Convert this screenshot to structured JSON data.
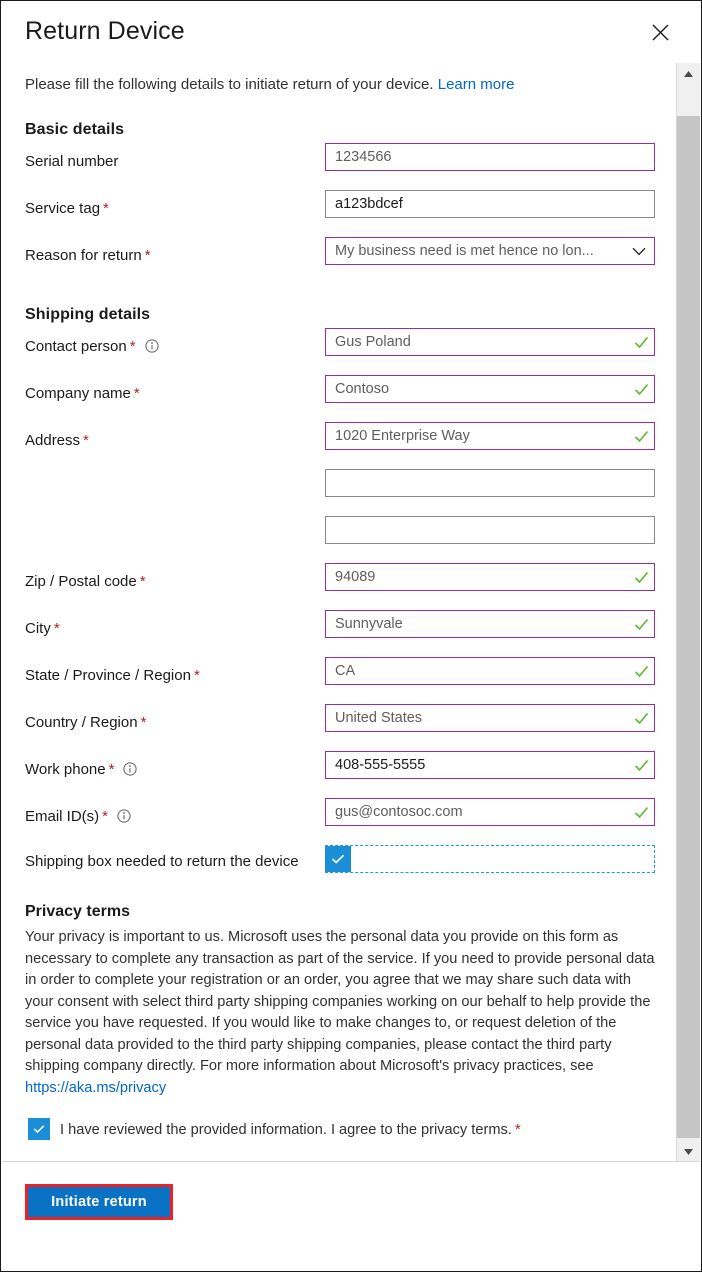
{
  "dialog": {
    "title": "Return Device",
    "close_icon": "close-icon",
    "intro_text": "Please fill the following details to initiate return of your device.",
    "intro_link": "Learn more"
  },
  "basic_details": {
    "heading": "Basic details",
    "fields": [
      {
        "label": "Serial number",
        "required": false,
        "info": false,
        "value": "1234566",
        "state": "valid",
        "muted": true,
        "checked": false,
        "dropdown": false
      },
      {
        "label": "Service tag",
        "required": true,
        "info": false,
        "value": "a123bdcef",
        "state": "normal",
        "muted": false,
        "checked": false,
        "dropdown": false
      },
      {
        "label": "Reason for return",
        "required": true,
        "info": false,
        "value": "My business need is met hence no lon...",
        "state": "valid",
        "muted": true,
        "checked": false,
        "dropdown": true
      }
    ]
  },
  "shipping_details": {
    "heading": "Shipping details",
    "fields": [
      {
        "label": "Contact person",
        "required": true,
        "info": true,
        "value": "Gus Poland",
        "state": "valid",
        "muted": true,
        "checked": true,
        "dropdown": false
      },
      {
        "label": "Company name",
        "required": true,
        "info": false,
        "value": "Contoso",
        "state": "valid",
        "muted": true,
        "checked": true,
        "dropdown": false
      },
      {
        "label": "Address",
        "required": true,
        "info": false,
        "value": "1020 Enterprise Way",
        "state": "valid",
        "muted": true,
        "checked": true,
        "dropdown": false
      },
      {
        "label": "",
        "required": false,
        "info": false,
        "value": "",
        "state": "normal",
        "muted": false,
        "checked": false,
        "dropdown": false
      },
      {
        "label": "",
        "required": false,
        "info": false,
        "value": "",
        "state": "normal",
        "muted": false,
        "checked": false,
        "dropdown": false
      },
      {
        "label": "Zip / Postal code",
        "required": true,
        "info": false,
        "value": "94089",
        "state": "valid",
        "muted": true,
        "checked": true,
        "dropdown": false
      },
      {
        "label": "City",
        "required": true,
        "info": false,
        "value": "Sunnyvale",
        "state": "valid",
        "muted": true,
        "checked": true,
        "dropdown": false
      },
      {
        "label": "State / Province / Region",
        "required": true,
        "info": false,
        "value": "CA",
        "state": "valid",
        "muted": true,
        "checked": true,
        "dropdown": false
      },
      {
        "label": "Country / Region",
        "required": true,
        "info": false,
        "value": "United States",
        "state": "valid",
        "muted": true,
        "checked": true,
        "dropdown": false
      },
      {
        "label": "Work phone",
        "required": true,
        "info": true,
        "value": "408-555-5555",
        "state": "valid",
        "muted": false,
        "checked": true,
        "dropdown": false
      },
      {
        "label": "Email ID(s)",
        "required": true,
        "info": true,
        "value": "gus@contosoc.com",
        "state": "valid",
        "muted": true,
        "checked": true,
        "dropdown": false
      }
    ],
    "shipping_box": {
      "label": "Shipping box needed to return the device",
      "checked": true
    }
  },
  "privacy": {
    "heading": "Privacy terms",
    "body": "Your privacy is important to us. Microsoft uses the personal data you provide on this form as necessary to complete any transaction as part of the service. If you need to provide personal data in order to complete your registration or an order, you agree that we may share such data with your consent with select third party shipping companies working on our behalf to help provide the service you have requested. If you would like to make changes to, or request deletion of the personal data provided to the third party shipping companies, please contact the third party shipping company directly. For more information about Microsoft's privacy practices, see ",
    "link": "https://aka.ms/privacy",
    "agree_label": "I have reviewed the provided information. I agree to the privacy terms.",
    "agree_required": "*",
    "agree_checked": true
  },
  "footer": {
    "initiate_label": "Initiate return"
  },
  "scrollbar": {
    "up_icon": "scroll-up-arrow-icon",
    "down_icon": "scroll-down-arrow-icon"
  },
  "colors": {
    "accent_blue": "#0a72c4",
    "valid_border": "#8f2fa8",
    "field_border": "#8a8886",
    "required_red": "#a4262c",
    "link_blue": "#0066cc",
    "checkmark_green": "#5bb82d",
    "checkbox_blue": "#1a8fd8",
    "highlight_red": "#ec2227"
  }
}
